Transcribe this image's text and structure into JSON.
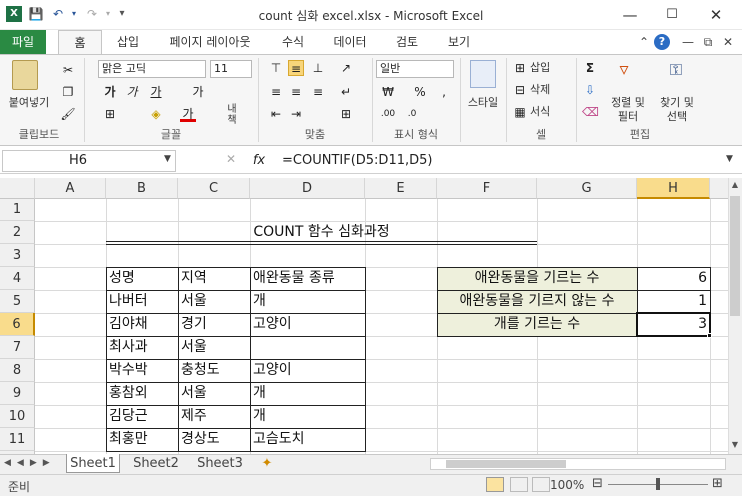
{
  "window": {
    "title": "count 심화 excel.xlsx - Microsoft Excel"
  },
  "ribbon_tabs": [
    "파일",
    "홈",
    "삽입",
    "페이지 레이아웃",
    "수식",
    "데이터",
    "검토",
    "보기"
  ],
  "ribbon": {
    "paste_label": "붙여넣기",
    "font_name": "맑은 고딕",
    "font_size": "11",
    "number_format": "일반",
    "style_label": "스타일",
    "insert_label": "삽입",
    "delete_label": "삭제",
    "format_label": "서식",
    "sort_label_1": "정렬 및",
    "sort_label_2": "필터",
    "find_label_1": "찾기 및",
    "find_label_2": "선택",
    "wrap_label": "내\n책",
    "groups": [
      "클립보드",
      "글꼴",
      "맞춤",
      "표시 형식",
      "셀",
      "편집"
    ]
  },
  "formula_bar": {
    "name_box": "H6",
    "fx": "fx",
    "formula": "=COUNTIF(D5:D11,D5)"
  },
  "columns": [
    "A",
    "B",
    "C",
    "D",
    "E",
    "F",
    "G",
    "H"
  ],
  "rows": [
    "1",
    "2",
    "3",
    "4",
    "5",
    "6",
    "7",
    "8",
    "9",
    "10",
    "11",
    "12"
  ],
  "sheet": {
    "title": "COUNT 함수 심화과정",
    "table_headers": [
      "성명",
      "지역",
      "애완동물 종류"
    ],
    "table_rows": [
      [
        "나버터",
        "서울",
        "개"
      ],
      [
        "김야채",
        "경기",
        "고양이"
      ],
      [
        "최사과",
        "서울",
        ""
      ],
      [
        "박수박",
        "충청도",
        "고양이"
      ],
      [
        "홍참외",
        "서울",
        "개"
      ],
      [
        "김당근",
        "제주",
        "개"
      ],
      [
        "최홍만",
        "경상도",
        "고슴도치"
      ]
    ],
    "summary": [
      {
        "label": "애완동물을 기르는 수",
        "value": "6"
      },
      {
        "label": "애완동물을 기르지 않는 수",
        "value": "1"
      },
      {
        "label": "개를 기르는 수",
        "value": "3"
      }
    ]
  },
  "sheet_tabs": [
    "Sheet1",
    "Sheet2",
    "Sheet3"
  ],
  "status": {
    "ready": "준비",
    "zoom": "100%"
  }
}
